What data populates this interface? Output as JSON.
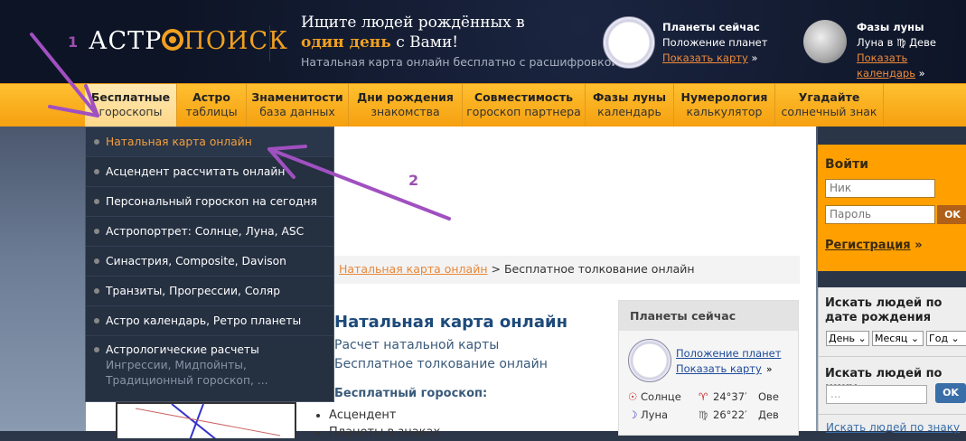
{
  "header": {
    "logo": {
      "left": "АСТР",
      "right": "ПОИСК"
    },
    "tagline_line1": "Ищите людей рождённых в",
    "tagline_bold": "один день",
    "tagline_rest": "с Вами!",
    "subtitle": "Натальная карта онлайн бесплатно с расшифровкой,",
    "planets": {
      "title": "Планеты сейчас",
      "text": "Положение планет",
      "link": "Показать карту",
      "arrow": "»"
    },
    "moon": {
      "title": "Фазы луны",
      "text": "Луна в ♍ Деве",
      "link": "Показать календарь",
      "arrow": "»"
    }
  },
  "nav": [
    {
      "title": "Бесплатные",
      "sub": "гороскопы"
    },
    {
      "title": "Астро",
      "sub": "таблицы"
    },
    {
      "title": "Знаменитости",
      "sub": "база данных"
    },
    {
      "title": "Дни рождения",
      "sub": "знакомства"
    },
    {
      "title": "Совместимость",
      "sub": "гороскоп партнера"
    },
    {
      "title": "Фазы луны",
      "sub": "календарь"
    },
    {
      "title": "Нумерология",
      "sub": "калькулятор"
    },
    {
      "title": "Угадайте",
      "sub": "солнечный знак"
    }
  ],
  "dropdown": [
    "Натальная карта онлайн",
    "Асцендент рассчитать онлайн",
    "Персональный гороскоп на сегодня",
    "Астропортрет: Солнце, Луна, ASC",
    "Синастрия, Composite, Davison",
    "Транзиты, Прогрессии, Соляр",
    "Астро календарь, Ретро планеты"
  ],
  "dropdown_last": {
    "title": "Астрологические расчеты",
    "sub": "Ингрессии, Мидпойнты, Традиционный гороскоп, ..."
  },
  "breadcrumb": {
    "link": "Натальная карта онлайн",
    "sep": ">",
    "current": "Бесплатное толкование онлайн"
  },
  "main": {
    "title": "Натальная карта онлайн",
    "line1": "Расчет натальной карты",
    "line2": "Бесплатное толкование онлайн",
    "section": "Бесплатный гороскоп:",
    "bullets": [
      "Асцендент",
      "Планеты в знаках"
    ]
  },
  "planets_box": {
    "title": "Планеты сейчас",
    "link1": "Положение планет",
    "link2": "Показать карту",
    "arrow": "»",
    "rows": [
      {
        "glyph": "☉",
        "name": "Солнце",
        "sign": "♈",
        "deg": "24°37′",
        "abbr": "Ове"
      },
      {
        "glyph": "☽",
        "name": "Луна",
        "sign": "♍",
        "deg": "26°22′",
        "abbr": "Дев"
      }
    ]
  },
  "login": {
    "title": "Войти",
    "nick_placeholder": "Ник",
    "pass_placeholder": "Пароль",
    "ok": "OK",
    "register": "Регистрация",
    "arrow": "»"
  },
  "search": {
    "by_date": "Искать людей по дате рождения",
    "day": "День",
    "month": "Месяц",
    "year": "Год",
    "by_nick": "Искать людей по нику",
    "nick_placeholder": "...",
    "ok": "OK",
    "by_sign": "Искать людей по знаку"
  },
  "annotations": {
    "one": "1",
    "two": "2"
  },
  "colors": {
    "accent": "#f0a020",
    "menu_bg": "#253041",
    "annotation": "#9b4fb0"
  }
}
